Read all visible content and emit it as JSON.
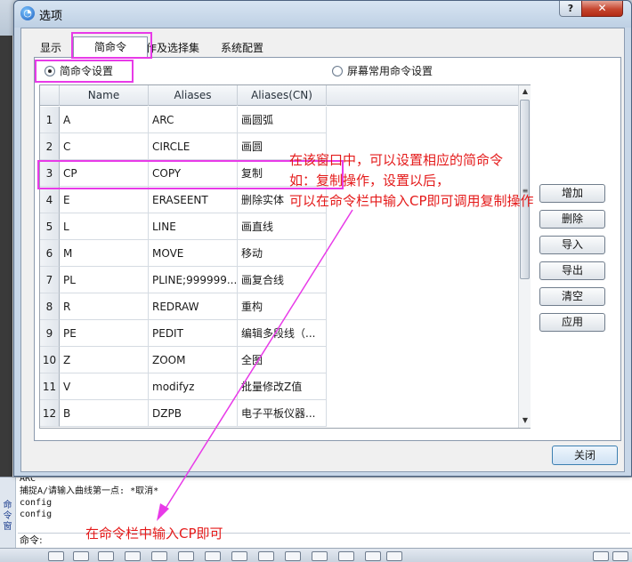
{
  "dialog": {
    "title": "选项",
    "help_label": "?",
    "close_label": "✕",
    "tabs": [
      {
        "label": "显示"
      },
      {
        "label": "简命令"
      },
      {
        "label": "操作及选择集"
      },
      {
        "label": "系统配置"
      }
    ],
    "radio_shortcmd": "简命令设置",
    "radio_screen": "屏幕常用命令设置",
    "columns": [
      "Name",
      "Aliases",
      "Aliases(CN)"
    ],
    "rows": [
      {
        "no": "1",
        "name": "A",
        "alias": "ARC",
        "cn": "画圆弧"
      },
      {
        "no": "2",
        "name": "C",
        "alias": "CIRCLE",
        "cn": "画圆"
      },
      {
        "no": "3",
        "name": "CP",
        "alias": "COPY",
        "cn": "复制"
      },
      {
        "no": "4",
        "name": "E",
        "alias": "ERASEENT",
        "cn": "删除实体"
      },
      {
        "no": "5",
        "name": "L",
        "alias": "LINE",
        "cn": "画直线"
      },
      {
        "no": "6",
        "name": "M",
        "alias": "MOVE",
        "cn": "移动"
      },
      {
        "no": "7",
        "name": "PL",
        "alias": "PLINE;999999...",
        "cn": "画复合线"
      },
      {
        "no": "8",
        "name": "R",
        "alias": "REDRAW",
        "cn": "重构"
      },
      {
        "no": "9",
        "name": "PE",
        "alias": "PEDIT",
        "cn": "编辑多段线（..."
      },
      {
        "no": "10",
        "name": "Z",
        "alias": "ZOOM",
        "cn": "全图"
      },
      {
        "no": "11",
        "name": "V",
        "alias": "modifyz",
        "cn": "批量修改Z值"
      },
      {
        "no": "12",
        "name": "B",
        "alias": "DZPB",
        "cn": "电子平板仪器..."
      }
    ],
    "buttons": {
      "add": "增加",
      "delete": "删除",
      "import": "导入",
      "export": "导出",
      "clear": "清空",
      "apply": "应用",
      "close": "关闭"
    }
  },
  "annotation": {
    "line1": "在该窗口中，可以设置相应的简命令",
    "line2": "如：复制操作，设置以后，",
    "line3": "可以在命令栏中输入CP即可调用复制操作",
    "bottom": "在命令栏中输入CP即可"
  },
  "command_area": {
    "side_label": [
      "命",
      "令",
      "窗"
    ],
    "lines": [
      "ARC",
      "捕捉A/请输入曲线第一点: *取消*",
      "config",
      "config"
    ],
    "prompt": "命令:"
  },
  "colors": {
    "highlight": "#e83ae8",
    "annotation": "#e41a1a"
  }
}
